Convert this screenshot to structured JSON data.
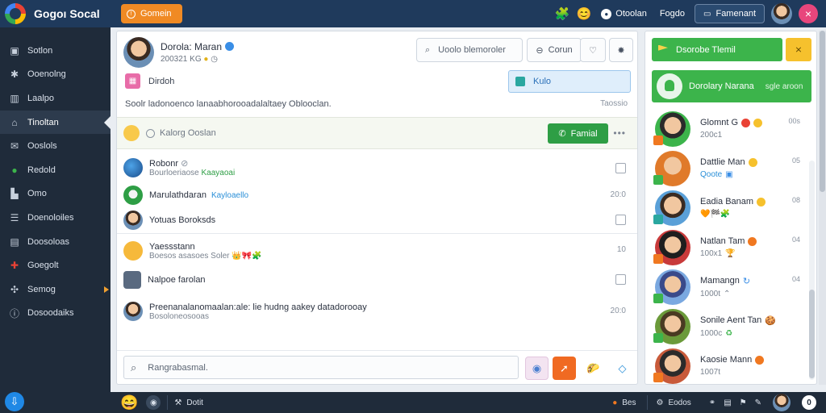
{
  "app": {
    "name": "Gogoı Socal",
    "badge": "Gomein"
  },
  "topbar": {
    "status_label": "Otoolan",
    "link_label": "Fogdo",
    "button_label": "Famenant",
    "close_symbol": "×"
  },
  "sidebar": {
    "items": [
      {
        "label": "Sotlon",
        "icon": "image-icon"
      },
      {
        "label": "Ooenolng",
        "icon": "puzzle-icon"
      },
      {
        "label": "Laalpo",
        "icon": "columns-icon"
      },
      {
        "label": "Tinoltan",
        "icon": "home-icon",
        "active": true
      },
      {
        "label": "Ooslols",
        "icon": "mail-icon"
      },
      {
        "label": "Redold",
        "icon": "green-dot-icon"
      },
      {
        "label": "Omo",
        "icon": "building-icon"
      },
      {
        "label": "Doenoloiles",
        "icon": "list-icon"
      },
      {
        "label": "Doosoloas",
        "icon": "grid-icon"
      },
      {
        "label": "Goegolt",
        "icon": "puzzle-color-icon"
      },
      {
        "label": "Semog",
        "icon": "network-icon"
      },
      {
        "label": "Dosoodaiks",
        "icon": "info-icon"
      }
    ]
  },
  "profile": {
    "name": "Dorola: Maran",
    "meta_number": "200321",
    "meta_extra": "KG",
    "search_placeholder": "Uoolo blemoroler",
    "button_label": "Corun",
    "status_label": "Dirdoh",
    "action_label": "Kulo",
    "description": "Soolr ladonoenco lanaabhorooadalaltaey Oblooclan.",
    "description_right": "Taossio"
  },
  "compose": {
    "placeholder": "Kalorg Ooslan",
    "button_label": "Famial",
    "more_symbol": "•••"
  },
  "feed": [
    {
      "title": "Robonr",
      "sub": "Bourloeriaose",
      "highlight": "Kaayaoai",
      "right": "check"
    },
    {
      "title": "Marulathdaran",
      "link": "Kayloaello",
      "right": "20:0"
    },
    {
      "title": "Yotuas Boroksds",
      "right": "check"
    },
    {
      "title": "Yaessstann",
      "sub": "Boesos asasoes Soler",
      "right": "10"
    },
    {
      "title": "Nalpoe farolan",
      "right": "check"
    },
    {
      "title": "Preenanalanomaalan:ale: lie hudng aakey datadorooay",
      "sub": "Bosoloneosooas",
      "right": "20:0"
    }
  ],
  "message": {
    "placeholder": "Rangrabasmal."
  },
  "right_panel": {
    "primary_button": "Dsorobe Tlemil",
    "secondary_symbol": "⨯",
    "card_title": "Dorolary Narana",
    "card_sub": "sgle aroon",
    "contacts": [
      {
        "name": "Glomnt G",
        "sub": "200c1",
        "time": "00s"
      },
      {
        "name": "Dattlie Man",
        "sub": "Qoote",
        "time": "05"
      },
      {
        "name": "Eadia Banam",
        "sub": "",
        "time": "08"
      },
      {
        "name": "Natlan Tam",
        "sub": "100x1",
        "time": "04"
      },
      {
        "name": "Mamangn",
        "sub": "1000t",
        "time": "04"
      },
      {
        "name": "Sonile Aent Tan",
        "sub": "1000c",
        "time": ""
      },
      {
        "name": "Kaosie Mann",
        "sub": "1007t",
        "time": ""
      }
    ]
  },
  "bottombar": {
    "left_label": "Dotit",
    "count_label": "Bes",
    "right_label": "Eodos"
  },
  "colors": {
    "topbar": "#1f3a5c",
    "sidebar": "#1f2b3a",
    "accent_green": "#3cb44b",
    "accent_orange": "#f08a24",
    "accent_blue": "#3a8ee6"
  }
}
